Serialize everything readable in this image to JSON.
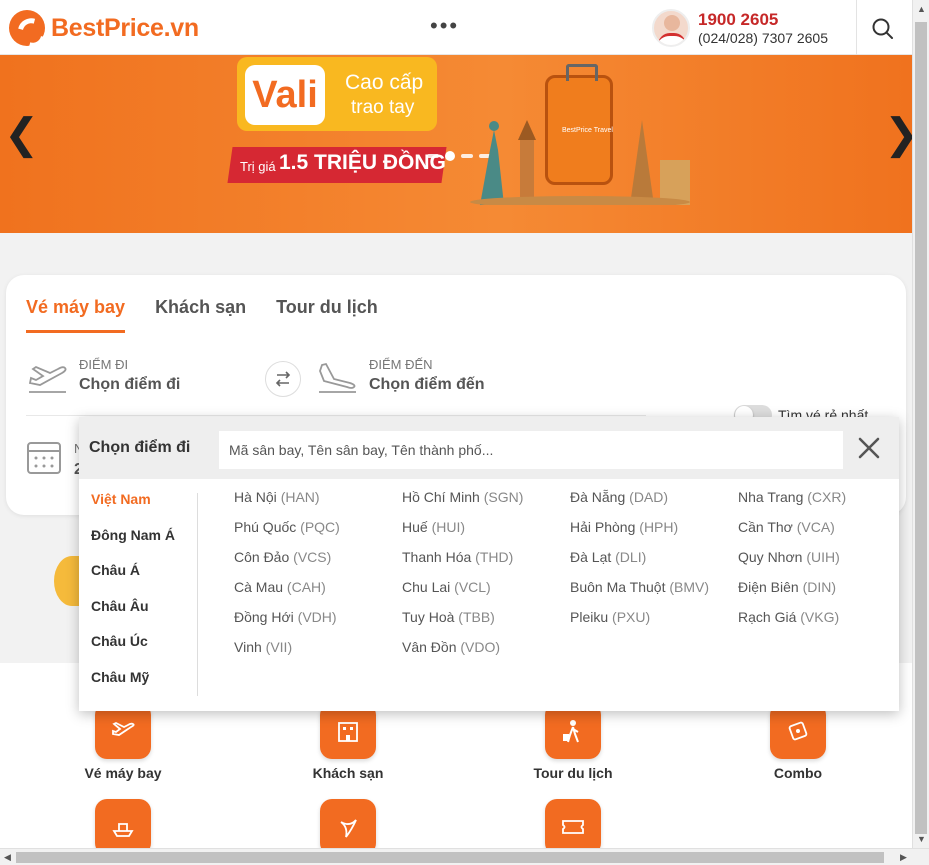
{
  "header": {
    "logo_text": "BestPrice.vn",
    "more_label": "•••",
    "hotline": "1900 2605",
    "phone": "(024/028) 7307 2605",
    "search_icon": "search-icon"
  },
  "banner": {
    "prev_arrow": "❮",
    "next_arrow": "❯",
    "vali": "Vali",
    "line1": "Cao cấp",
    "line2": "trao tay",
    "price_label": "Trị giá",
    "price_value": "1.5 TRIỆU ĐỒNG",
    "suitcase_brand": "BestPrice Travel",
    "active_slide": 2,
    "slide_count": 4
  },
  "search": {
    "tabs": [
      "Vé máy bay",
      "Khách sạn",
      "Tour du lịch"
    ],
    "active_tab": 0,
    "from_label": "ĐIỂM ĐI",
    "from_value": "Chọn điểm đi",
    "to_label": "ĐIỂM ĐẾN",
    "to_value": "Chọn điểm đến",
    "date_label_partial": "N",
    "date_value_partial": "2",
    "cheapest_toggle_label": "Tìm vé rẻ nhất",
    "cheapest_toggle_on": false
  },
  "dropdown": {
    "title": "Chọn điểm đi",
    "placeholder": "Mã sân bay, Tên sân bay, Tên thành phố...",
    "close_icon": "close-icon",
    "regions": [
      "Việt Nam",
      "Đông Nam Á",
      "Châu Á",
      "Châu Âu",
      "Châu Úc",
      "Châu Mỹ"
    ],
    "active_region": 0,
    "cities": [
      {
        "name": "Hà Nội",
        "code": "(HAN)"
      },
      {
        "name": "Hồ Chí Minh",
        "code": "(SGN)"
      },
      {
        "name": "Đà Nẵng",
        "code": "(DAD)"
      },
      {
        "name": "Nha Trang",
        "code": "(CXR)"
      },
      {
        "name": "Phú Quốc",
        "code": "(PQC)"
      },
      {
        "name": "Huế",
        "code": "(HUI)"
      },
      {
        "name": "Hải Phòng",
        "code": "(HPH)"
      },
      {
        "name": "Cần Thơ",
        "code": "(VCA)"
      },
      {
        "name": "Côn Đảo",
        "code": "(VCS)"
      },
      {
        "name": "Thanh Hóa",
        "code": "(THD)"
      },
      {
        "name": "Đà Lạt",
        "code": "(DLI)"
      },
      {
        "name": "Quy Nhơn",
        "code": "(UIH)"
      },
      {
        "name": "Cà Mau",
        "code": "(CAH)"
      },
      {
        "name": "Chu Lai",
        "code": "(VCL)"
      },
      {
        "name": "Buôn Ma Thuột",
        "code": "(BMV)"
      },
      {
        "name": "Điện Biên",
        "code": "(DIN)"
      },
      {
        "name": "Đồng Hới",
        "code": "(VDH)"
      },
      {
        "name": "Tuy Hoà",
        "code": "(TBB)"
      },
      {
        "name": "Pleiku",
        "code": "(PXU)"
      },
      {
        "name": "Rạch Giá",
        "code": "(VKG)"
      },
      {
        "name": "Vinh",
        "code": "(VII)"
      },
      {
        "name": "Vân Đồn",
        "code": "(VDO)"
      }
    ]
  },
  "services": {
    "row1": [
      {
        "label": "Vé máy bay",
        "icon": "airplane-ticket-icon"
      },
      {
        "label": "Khách sạn",
        "icon": "hotel-icon"
      },
      {
        "label": "Tour du lịch",
        "icon": "traveler-icon"
      },
      {
        "label": "Combo",
        "icon": "combo-tag-icon"
      }
    ],
    "row2_icons": [
      "cruise-icon",
      "airline-logo-icon",
      "voucher-ticket-icon"
    ]
  },
  "colors": {
    "brand": "#f26b21",
    "hotline": "#c62828",
    "banner": "#f0721e",
    "price_tag": "#d62833"
  }
}
